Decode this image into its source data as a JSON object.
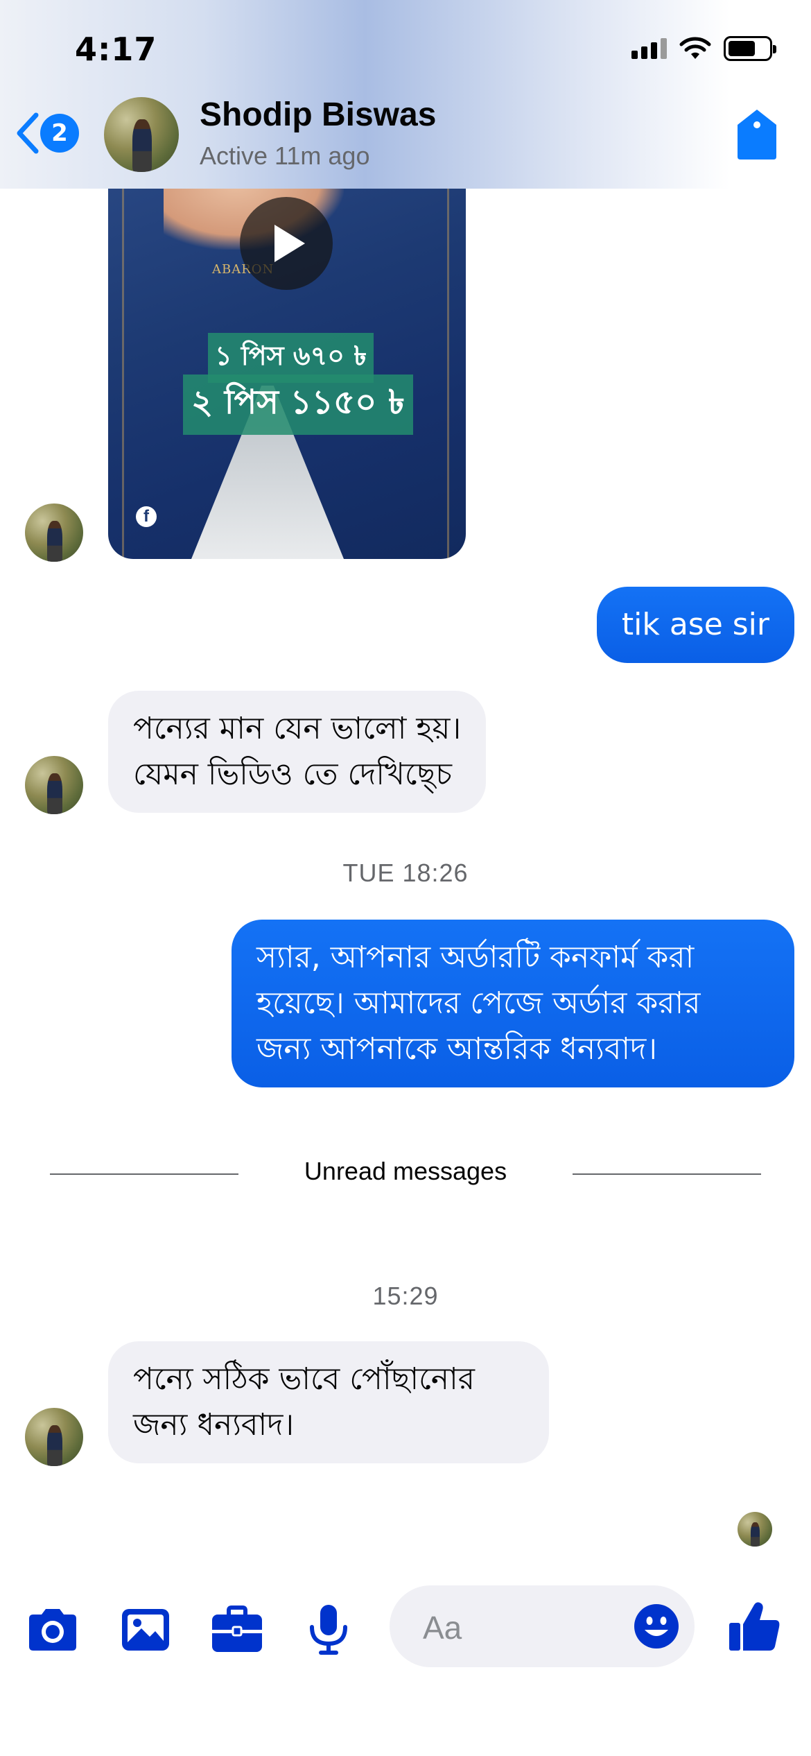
{
  "status_bar": {
    "time": "4:17"
  },
  "header": {
    "back_badge_count": "2",
    "contact_name": "Shodip Biswas",
    "contact_status": "Active 11m ago"
  },
  "messages": {
    "video": {
      "brand": "ABARON",
      "price_line1": "১ পিস ৬৭০ ৳",
      "price_line2": "২ পিস ১১৫০ ৳",
      "source_icon": "facebook-icon"
    },
    "sent_1": "tik ase sir",
    "received_1": [
      "পন্যের মান যেন ভালো হয়।",
      "যেমন ভিডিও তে দেখিছ্চে"
    ],
    "timestamp_1": "TUE 18:26",
    "sent_2": [
      "স্যার, আপনার অর্ডারটি কনফার্ম করা",
      "হয়েছে। আমাদের পেজে অর্ডার করার",
      "জন্য আপনাকে আন্তরিক ধন্যবাদ।"
    ],
    "unread_label": "Unread messages",
    "timestamp_2": "15:29",
    "received_2": [
      "পন্যে সঠিক ভাবে পোঁছানোর",
      "জন্য ধন্যবাদ।"
    ]
  },
  "composer": {
    "placeholder": "Aa",
    "tools": [
      "camera-icon",
      "gallery-icon",
      "briefcase-icon",
      "microphone-icon"
    ],
    "emoji_icon": "emoji-icon",
    "send_icon": "thumbs-up-icon"
  },
  "colors": {
    "accent": "#0a7cff",
    "icon_blue": "#0033cc",
    "outgoing_bubble": "#1472f5",
    "incoming_bubble": "#f0f0f5"
  }
}
